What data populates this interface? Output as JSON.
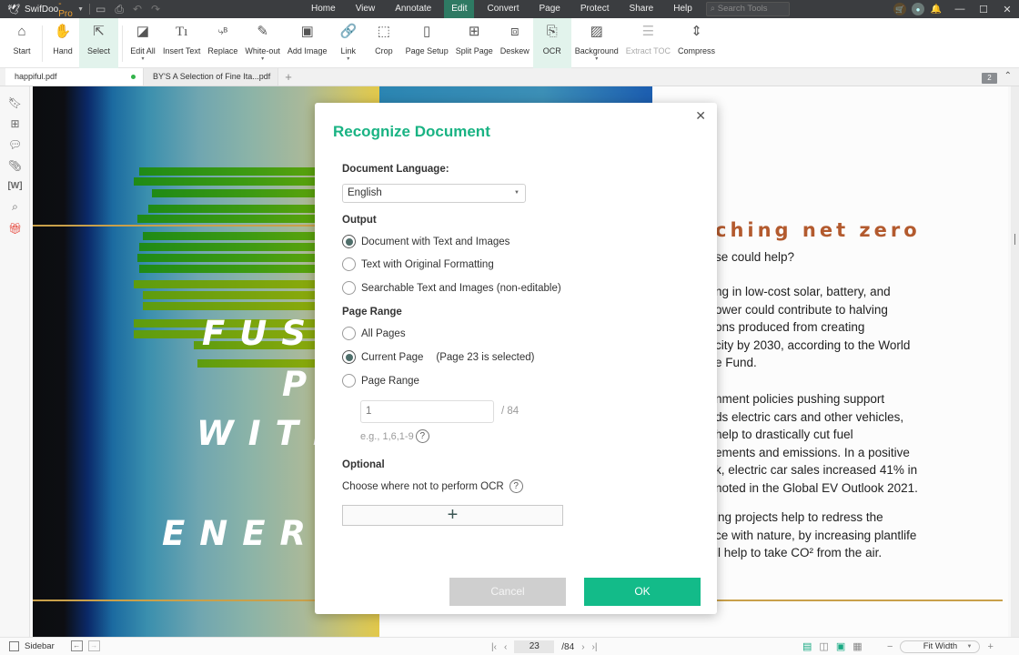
{
  "app": {
    "name": "SwifDoo",
    "edition": "-Pro",
    "accent": "#19b383"
  },
  "menu": [
    "Home",
    "View",
    "Annotate",
    "Edit",
    "Convert",
    "Page",
    "Protect",
    "Share",
    "Help"
  ],
  "menu_active": "Edit",
  "search_placeholder": "Search Tools",
  "titlebar_icons": [
    "cart-icon",
    "account-icon",
    "bell-icon"
  ],
  "window_controls": [
    "minimize",
    "maximize",
    "close"
  ],
  "toolbar": {
    "tools": [
      {
        "label": "Start",
        "icon": "home-icon"
      },
      {
        "label": "Hand",
        "icon": "hand-icon"
      },
      {
        "label": "Select",
        "icon": "cursor-icon",
        "active": true
      },
      {
        "label": "Edit All",
        "icon": "edit-icon",
        "dropdown": true
      },
      {
        "label": "Insert Text",
        "icon": "insert-text-icon"
      },
      {
        "label": "Replace",
        "icon": "replace-icon"
      },
      {
        "label": "White-out",
        "icon": "eraser-icon",
        "dropdown": true
      },
      {
        "label": "Add Image",
        "icon": "image-icon"
      },
      {
        "label": "Link",
        "icon": "link-icon",
        "dropdown": true
      },
      {
        "label": "Crop",
        "icon": "crop-icon"
      },
      {
        "label": "Page Setup",
        "icon": "page-setup-icon"
      },
      {
        "label": "Split Page",
        "icon": "split-page-icon"
      },
      {
        "label": "Deskew",
        "icon": "deskew-icon"
      },
      {
        "label": "OCR",
        "icon": "ocr-icon",
        "active": true
      },
      {
        "label": "Background",
        "icon": "background-icon",
        "dropdown": true
      },
      {
        "label": "Extract TOC",
        "icon": "extract-toc-icon",
        "disabled": true
      },
      {
        "label": "Compress",
        "icon": "compress-icon"
      }
    ]
  },
  "tabs": [
    {
      "label": "happiful.pdf",
      "active": true,
      "modified": true
    },
    {
      "label": "BY'S A Selection of Fine Ita...pdf",
      "active": false
    }
  ],
  "open_count": "2",
  "document": {
    "cover_words": [
      "FUSI",
      "P",
      "WITH",
      "ENERG"
    ],
    "heading": "ching net zero",
    "paragraphs": [
      [
        "se could help?"
      ],
      [
        "ng in low-cost solar, battery, and",
        "ower could contribute to halving",
        "ons produced from creating",
        "city by 2030, according to the World",
        "e Fund."
      ],
      [
        "nment policies pushing support",
        "ds electric cars and other vehicles,",
        "help to drastically cut fuel",
        "ements and emissions. In a positive",
        "k, electric car sales increased 41% in",
        "noted in the Global EV Outlook 2021."
      ],
      [
        "ing projects help to redress the",
        "ce with nature, by increasing plantlife",
        "ll help to take CO² from the air."
      ]
    ]
  },
  "dialog": {
    "title": "Recognize Document",
    "language_label": "Document Language:",
    "language_value": "English",
    "output_label": "Output",
    "output_options": [
      {
        "label": "Document with Text and Images",
        "selected": true
      },
      {
        "label": "Text with Original Formatting",
        "selected": false
      },
      {
        "label": "Searchable Text and Images (non-editable)",
        "selected": false
      }
    ],
    "page_range_label": "Page Range",
    "page_range_options": [
      {
        "label": "All Pages",
        "selected": false,
        "note": ""
      },
      {
        "label": "Current Page",
        "selected": true,
        "note": "(Page 23 is selected)"
      },
      {
        "label": "Page Range",
        "selected": false,
        "note": ""
      }
    ],
    "range_value": "1",
    "range_total": "/ 84",
    "range_hint": "e.g., 1,6,1-9",
    "optional_label": "Optional",
    "optional_text": "Choose where not to perform OCR",
    "cancel_label": "Cancel",
    "ok_label": "OK"
  },
  "statusbar": {
    "sidebar_label": "Sidebar",
    "current_page": "23",
    "total_pages": "/84",
    "zoom": "Fit Width"
  }
}
